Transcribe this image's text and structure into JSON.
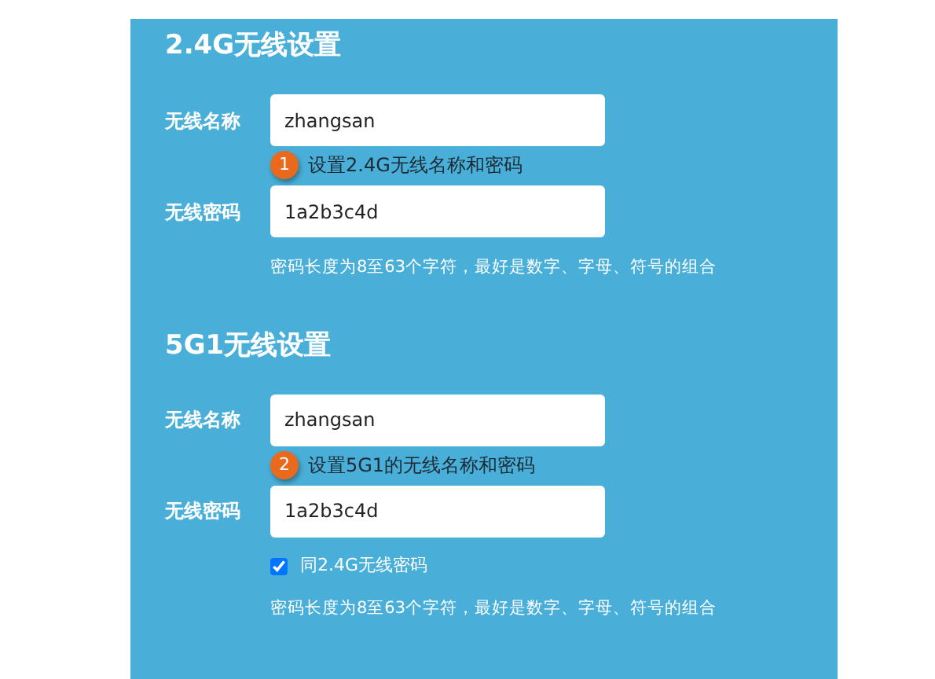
{
  "sections": [
    {
      "title": "2.4G无线设置",
      "items": [
        {
          "kind": "field",
          "label": "无线名称",
          "value": "zhangsan"
        },
        {
          "kind": "callout",
          "number": "1",
          "text": "设置2.4G无线名称和密码"
        },
        {
          "kind": "field",
          "label": "无线密码",
          "value": "1a2b3c4d"
        },
        {
          "kind": "hint",
          "text": "密码长度为8至63个字符，最好是数字、字母、符号的组合"
        }
      ]
    },
    {
      "title": "5G1无线设置",
      "items": [
        {
          "kind": "field",
          "label": "无线名称",
          "value": "zhangsan"
        },
        {
          "kind": "callout",
          "number": "2",
          "text": "设置5G1的无线名称和密码"
        },
        {
          "kind": "field",
          "label": "无线密码",
          "value": "1a2b3c4d"
        },
        {
          "kind": "checkbox",
          "label": "同2.4G无线密码",
          "checked": true
        },
        {
          "kind": "hint",
          "text": "密码长度为8至63个字符，最好是数字、字母、符号的组合"
        }
      ]
    }
  ]
}
